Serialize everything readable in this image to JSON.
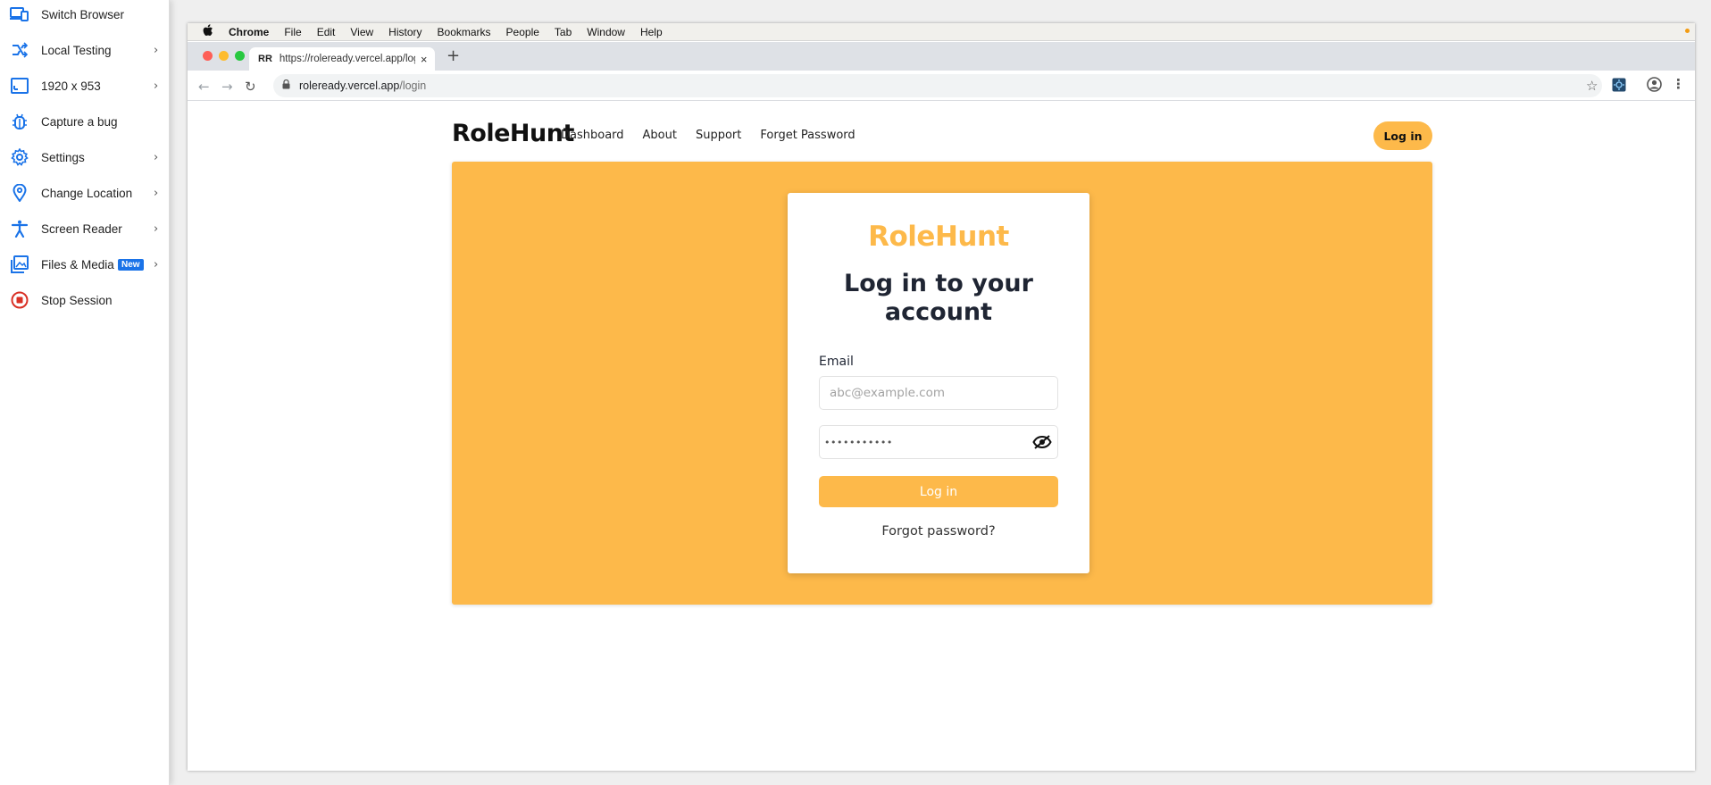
{
  "sidebar": {
    "items": [
      {
        "label": "Switch Browser",
        "icon": "switch-browser-icon",
        "chevron": false
      },
      {
        "label": "Local Testing",
        "icon": "local-testing-icon",
        "chevron": true
      },
      {
        "label": "1920 x 953",
        "icon": "resolution-icon",
        "chevron": true
      },
      {
        "label": "Capture a bug",
        "icon": "bug-icon",
        "chevron": false
      },
      {
        "label": "Settings",
        "icon": "gear-icon",
        "chevron": true
      },
      {
        "label": "Change Location",
        "icon": "location-pin-icon",
        "chevron": true
      },
      {
        "label": "Screen Reader",
        "icon": "accessibility-icon",
        "chevron": true
      },
      {
        "label": "Files & Media",
        "icon": "image-gallery-icon",
        "chevron": true,
        "badge": "New"
      },
      {
        "label": "Stop Session",
        "icon": "stop-icon",
        "chevron": false
      }
    ],
    "chevron_glyph": "›",
    "icon_color": "#1a73e8",
    "stop_color": "#d93025"
  },
  "mac_menu": {
    "apple": "",
    "app": "Chrome",
    "items": [
      "File",
      "Edit",
      "View",
      "History",
      "Bookmarks",
      "People",
      "Tab",
      "Window",
      "Help"
    ]
  },
  "browser": {
    "tab": {
      "favicon": "RR",
      "title": "https://roleready.vercel.app/login",
      "close": "×"
    },
    "new_tab": "+",
    "url_host": "roleready.vercel.app",
    "url_path": "/login"
  },
  "site": {
    "brand": "RoleHunt",
    "nav": [
      "Dashboard",
      "About",
      "Support",
      "Forget Password"
    ],
    "login_button": "Log in",
    "accent": "#fdb94a"
  },
  "login_card": {
    "brand": "RoleHunt",
    "title": "Log in to your account",
    "email_label": "Email",
    "email_placeholder": "abc@example.com",
    "password_masked": "•••••••••••",
    "submit": "Log in",
    "forgot": "Forgot password?"
  }
}
